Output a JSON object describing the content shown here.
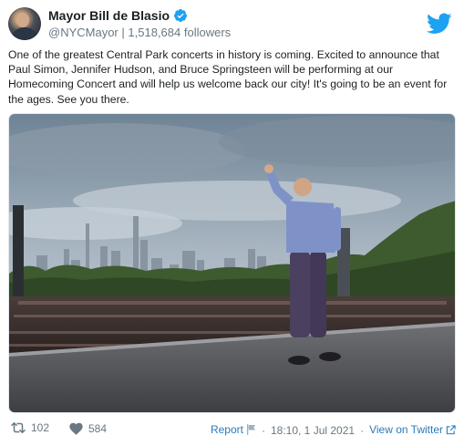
{
  "author": {
    "name": "Mayor Bill de Blasio",
    "handle": "@NYCMayor",
    "separator": "|",
    "followers": "1,518,684 followers"
  },
  "tweet": {
    "text": "One of the greatest Central Park concerts in history is coming. Excited to announce that Paul Simon, Jennifer Hudson, and Bruce Springsteen will be performing at our Homecoming Concert and will help us welcome back our city! It's going to be an event for the ages. See you there."
  },
  "footer": {
    "retweets": "102",
    "likes": "584",
    "report_label": "Report",
    "timestamp": "18:10, 1 Jul 2021",
    "view_label": "View on Twitter"
  },
  "icons": {
    "verified": "verified-badge-icon",
    "twitter": "twitter-bird-icon",
    "retweet": "retweet-icon",
    "heart": "heart-icon",
    "report": "flag-icon",
    "external": "external-link-icon"
  },
  "colors": {
    "twitter_blue": "#1da1f2",
    "link_blue": "#2b7bb9",
    "muted": "#697882",
    "text": "#1c2022"
  }
}
